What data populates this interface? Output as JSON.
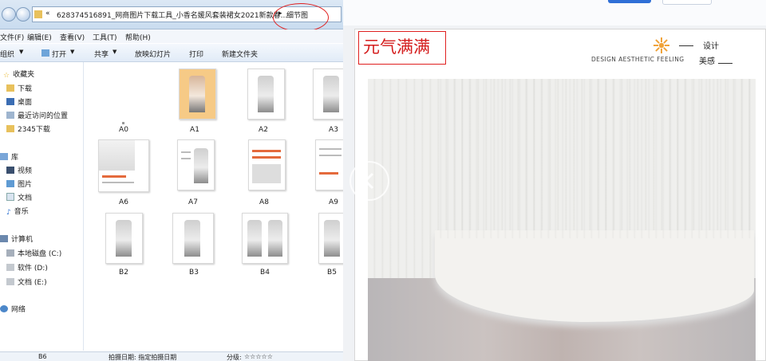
{
  "address": {
    "prefix": "«",
    "path": "628374516891_网商图片下载工具_小香名媛风套装裙女2021新款春...",
    "sep": "▸",
    "current": "细节图"
  },
  "menu": [
    "文件(F)",
    "编辑(E)",
    "查看(V)",
    "工具(T)",
    "帮助(H)"
  ],
  "toolbar": {
    "organize": "组织",
    "open": "打开",
    "share": "共享",
    "slideshow": "放映幻灯片",
    "print": "打印",
    "new_folder": "新建文件夹"
  },
  "nav": {
    "favorites": "收藏夹",
    "fav_items": [
      "下载",
      "桌面",
      "最近访问的位置",
      "2345下载"
    ],
    "library": "库",
    "lib_items": [
      "视频",
      "图片",
      "文档",
      "音乐"
    ],
    "computer": "计算机",
    "drives": [
      "本地磁盘 (C:)",
      "软件 (D:)",
      "文档 (E:)"
    ],
    "network": "网络"
  },
  "files": [
    "A0",
    "A1",
    "A2",
    "A3",
    "A6",
    "A7",
    "A8",
    "A9",
    "B2",
    "B3",
    "B4",
    "B5"
  ],
  "status": {
    "name": "B6",
    "date_label": "拍摄日期: 指定拍摄日期",
    "rating_label": "分级:",
    "stars": "☆☆☆☆☆"
  },
  "viewer": {
    "title": "元气满满",
    "design_cn": "设计",
    "beauty_cn": "美感",
    "design_en": "DESIGN AESTHETIC FEELING"
  },
  "colors": {
    "annotation": "#e02020",
    "title_red": "#d41c1c",
    "accent_blue": "#2f6fd6"
  }
}
